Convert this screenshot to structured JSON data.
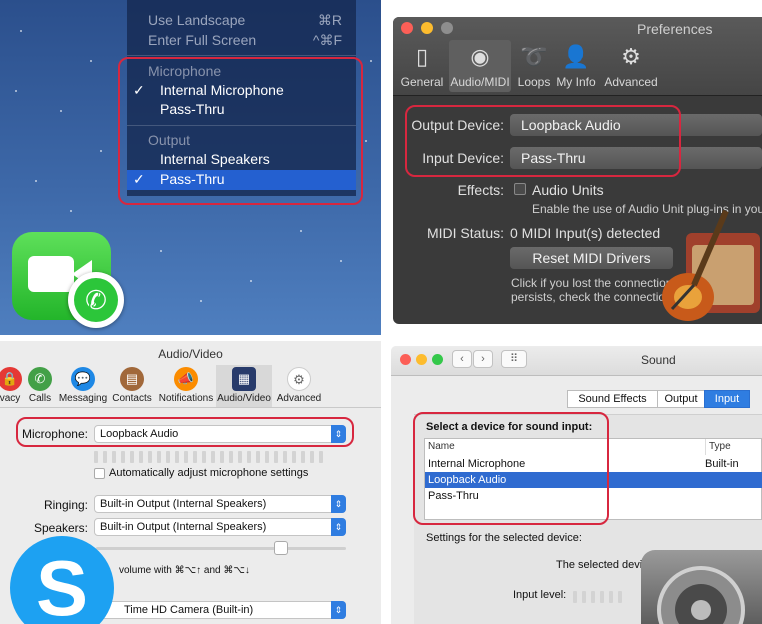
{
  "menu": {
    "items_top": [
      {
        "label": "Use Landscape",
        "shortcut": "⌘R"
      },
      {
        "label": "Enter Full Screen",
        "shortcut": "^⌘F"
      }
    ],
    "microphone_header": "Microphone",
    "microphone_items": [
      "Internal Microphone",
      "Pass-Thru"
    ],
    "output_header": "Output",
    "output_items": [
      "Internal Speakers",
      "Pass-Thru"
    ],
    "check": "✓"
  },
  "preferences": {
    "title": "Preferences",
    "tabs": [
      "General",
      "Audio/MIDI",
      "Loops",
      "My Info",
      "Advanced"
    ],
    "output_device_label": "Output Device:",
    "output_device_value": "Loopback Audio",
    "input_device_label": "Input Device:",
    "input_device_value": "Pass-Thru",
    "effects_label": "Effects:",
    "audio_units_label": "Audio Units",
    "audio_units_desc": "Enable the use of Audio Unit plug-ins in your",
    "midi_status_label": "MIDI Status:",
    "midi_status_value": "0 MIDI Input(s) detected",
    "reset_button": "Reset MIDI Drivers",
    "note_line1": "Click if you lost the connection",
    "note_line2": "persists, check the connectio"
  },
  "skype": {
    "title": "Audio/Video",
    "tabs": [
      "vacy",
      "Calls",
      "Messaging",
      "Contacts",
      "Notifications",
      "Audio/Video",
      "Advanced"
    ],
    "microphone_label": "Microphone:",
    "microphone_value": "Loopback Audio",
    "auto_adjust_label": "Automatically adjust microphone settings",
    "ringing_label": "Ringing:",
    "ringing_value": "Built-in Output (Internal Speakers)",
    "speakers_label": "Speakers:",
    "speakers_value": "Built-in Output (Internal Speakers)",
    "volume_hint": "volume with ⌘⌥↑ and ⌘⌥↓",
    "camera_value": "Time HD Camera (Built-in)",
    "logo_letter": "S"
  },
  "sound": {
    "title": "Sound",
    "tabs": [
      "Sound Effects",
      "Output",
      "Input"
    ],
    "select_label": "Select a device for sound input:",
    "col_name": "Name",
    "col_type": "Type",
    "rows": [
      {
        "name": "Internal Microphone",
        "type": "Built-in"
      },
      {
        "name": "Loopback Audio",
        "type": ""
      },
      {
        "name": "Pass-Thru",
        "type": ""
      }
    ],
    "settings_label": "Settings for the selected device:",
    "selected_device_text": "The selected devi",
    "input_level_label": "Input level:"
  },
  "colors": {
    "highlight_box": "#d7273f",
    "selection_blue": "#2f6bd0",
    "menu_highlight": "#2460d0"
  }
}
